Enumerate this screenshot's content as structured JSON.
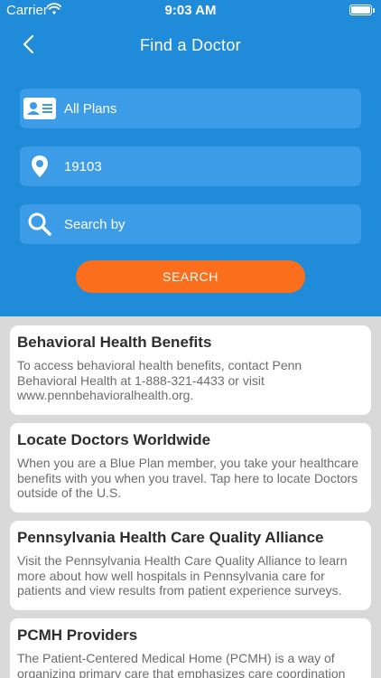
{
  "status": {
    "carrier": "Carrier",
    "time": "9:03 AM"
  },
  "header": {
    "title": "Find a Doctor"
  },
  "filters": {
    "plan": {
      "value": "All Plans",
      "icon": "id-card-icon"
    },
    "location": {
      "value": "19103",
      "icon": "location-pin-icon"
    },
    "search": {
      "placeholder": "Search by",
      "icon": "search-icon"
    }
  },
  "search_button": {
    "label": "SEARCH"
  },
  "cards": [
    {
      "title": "Behavioral Health Benefits",
      "body": "To access behavioral health benefits, contact Penn Behavioral Health at 1-888-321-4433 or visit www.pennbehavioralhealth.org."
    },
    {
      "title": "Locate Doctors Worldwide",
      "body": "When you are a Blue Plan member, you take your healthcare benefits with you when you travel. Tap here to locate Doctors outside of the U.S."
    },
    {
      "title": "Pennsylvania Health Care Quality Alliance",
      "body": "Visit the Pennsylvania Health Care Quality Alliance to learn more about how well hospitals in Pennsylvania care for patients and view results from patient experience surveys."
    },
    {
      "title": "PCMH Providers",
      "body": "The Patient-Centered Medical Home (PCMH) is a way of organizing primary care that emphasizes care coordination"
    }
  ],
  "colors": {
    "header_bg": "#1f8bd9",
    "field_bg": "#3d9ce8",
    "accent_orange": "#fb6f1c",
    "list_bg": "#d9d9d9"
  }
}
